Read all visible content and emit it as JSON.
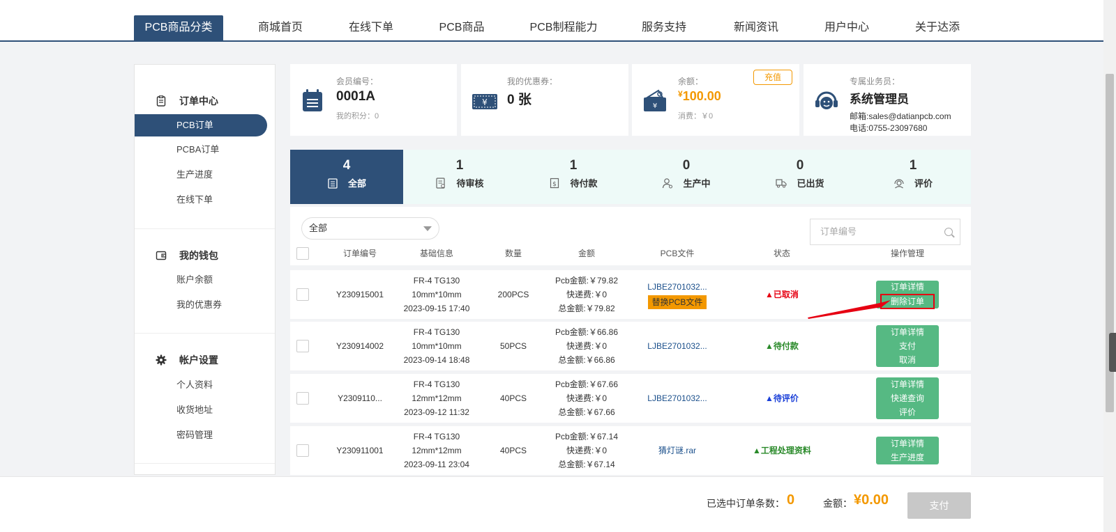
{
  "nav": {
    "items": [
      "PCB商品分类",
      "商城首页",
      "在线下单",
      "PCB商品",
      "PCB制程能力",
      "服务支持",
      "新闻资讯",
      "用户中心",
      "关于达添"
    ]
  },
  "sidebar": {
    "order_center": "订单中心",
    "order_items": [
      "PCB订单",
      "PCBA订单",
      "生产进度",
      "在线下单"
    ],
    "wallet": "我的钱包",
    "wallet_items": [
      "账户余额",
      "我的优惠券"
    ],
    "account": "帐户设置",
    "account_items": [
      "个人资料",
      "收货地址",
      "密码管理"
    ]
  },
  "cards": {
    "member": {
      "label": "会员编号：",
      "value": "0001A",
      "sub": "我的积分：0"
    },
    "coupon": {
      "label": "我的优惠券：",
      "value": "0 张"
    },
    "balance": {
      "label": "余额：",
      "currency": "¥",
      "value": "100.00",
      "sub": "消费：￥0",
      "recharge": "充值"
    },
    "agent": {
      "label": "专属业务员：",
      "value": "系统管理员",
      "email": "邮箱:sales@datianpcb.com",
      "phone": "电话:0755-23097680"
    }
  },
  "tabs": [
    {
      "count": "4",
      "label": "全部",
      "icon": "list-icon"
    },
    {
      "count": "1",
      "label": "待审核",
      "icon": "review-icon"
    },
    {
      "count": "1",
      "label": "待付款",
      "icon": "payment-icon"
    },
    {
      "count": "0",
      "label": "生产中",
      "icon": "worker-icon"
    },
    {
      "count": "0",
      "label": "已出货",
      "icon": "shipping-icon"
    },
    {
      "count": "1",
      "label": "评价",
      "icon": "review-face-icon"
    }
  ],
  "filter": {
    "selected": "全部",
    "search_placeholder": "订单编号"
  },
  "table": {
    "headers": [
      "订单编号",
      "基础信息",
      "数量",
      "金额",
      "PCB文件",
      "状态",
      "操作管理"
    ],
    "rows": [
      {
        "id": "Y230915001",
        "material": "FR-4 TG130",
        "size": "10mm*10mm",
        "date": "2023-09-15 17:40",
        "qty": "200PCS",
        "pcb": "Pcb金额:￥79.82",
        "ship": "快递费:￥0",
        "total": "总金额:￥79.82",
        "file": "LJBE2701032...",
        "replace": "替换PCB文件",
        "status": "▲已取消",
        "ops": [
          "订单详情",
          "删除订单"
        ]
      },
      {
        "id": "Y230914002",
        "material": "FR-4 TG130",
        "size": "10mm*10mm",
        "date": "2023-09-14 18:48",
        "qty": "50PCS",
        "pcb": "Pcb金额:￥66.86",
        "ship": "快递费:￥0",
        "total": "总金额:￥66.86",
        "file": "LJBE2701032...",
        "status": "▲待付款",
        "ops": [
          "订单详情",
          "支付",
          "取消"
        ]
      },
      {
        "id": "Y2309110...",
        "material": "FR-4 TG130",
        "size": "12mm*12mm",
        "date": "2023-09-12 11:32",
        "qty": "40PCS",
        "pcb": "Pcb金额:￥67.66",
        "ship": "快递费:￥0",
        "total": "总金额:￥67.66",
        "file": "LJBE2701032...",
        "status": "▲待评价",
        "ops": [
          "订单详情",
          "快递查询",
          "评价"
        ]
      },
      {
        "id": "Y230911001",
        "material": "FR-4 TG130",
        "size": "12mm*12mm",
        "date": "2023-09-11 23:04",
        "qty": "40PCS",
        "pcb": "Pcb金额:￥67.14",
        "ship": "快递费:￥0",
        "total": "总金额:￥67.14",
        "file": "猜灯谜.rar",
        "status": "▲工程处理资料",
        "ops": [
          "订单详情",
          "生产进度"
        ]
      }
    ]
  },
  "footer": {
    "selected_label": "已选中订单条数：",
    "selected_count": "0",
    "amount_label": "金额：",
    "amount": "¥0.00",
    "pay": "支付"
  },
  "colors": {
    "primary": "#2e5078",
    "accent": "#f39800",
    "ops_green": "#56b983",
    "cancel_red": "#e60012"
  }
}
